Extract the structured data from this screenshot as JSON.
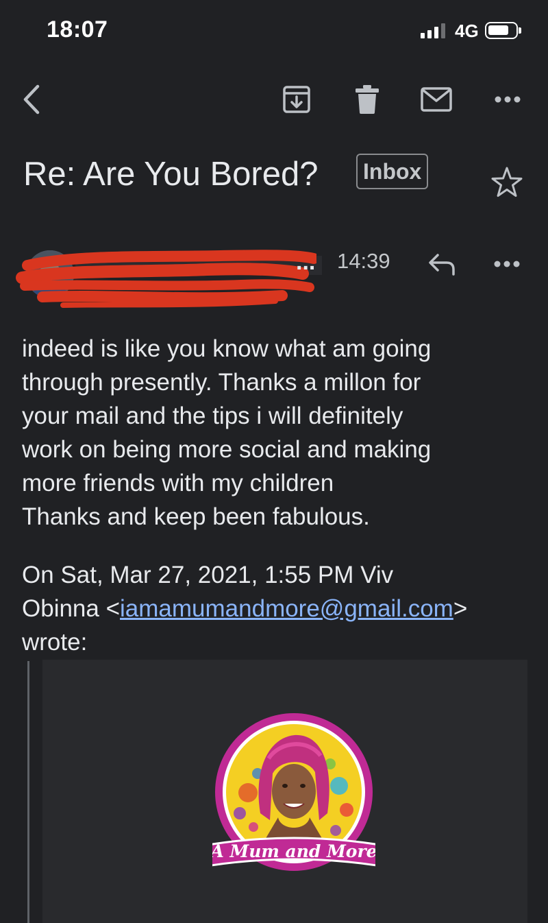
{
  "status_bar": {
    "time": "18:07",
    "network": "4G",
    "signal_bars": 3,
    "battery_level": 0.75
  },
  "toolbar": {
    "back_icon": "chevron-left-icon",
    "archive_icon": "archive-icon",
    "delete_icon": "trash-icon",
    "mark_unread_icon": "mail-icon",
    "more_icon": "more-horizontal-icon"
  },
  "email": {
    "subject": "Re: Are You Bored?",
    "label": "Inbox",
    "starred": false,
    "sender": {
      "name_fragment": "...",
      "redacted": true
    },
    "time": "14:39",
    "body_lines": [
      "indeed is like you know what am going",
      "through presently. Thanks a millon for",
      "your mail and the tips i will definitely",
      "work on being more social and making",
      "more friends with my children",
      "Thanks and keep been fabulous."
    ],
    "quote_header": {
      "line1": "On Sat, Mar 27, 2021, 1:55 PM Viv",
      "line2_prefix": "Obinna <",
      "email": "iamamumandmore@gmail.com",
      "line2_suffix": ">",
      "line3": "wrote:"
    },
    "quoted_logo_text": "A Mum and More"
  },
  "colors": {
    "background": "#202124",
    "text": "#e8eaed",
    "link": "#8ab4f8",
    "redaction": "#d9361f",
    "logo_ring": "#c02a95",
    "logo_fill": "#f4cf23"
  }
}
